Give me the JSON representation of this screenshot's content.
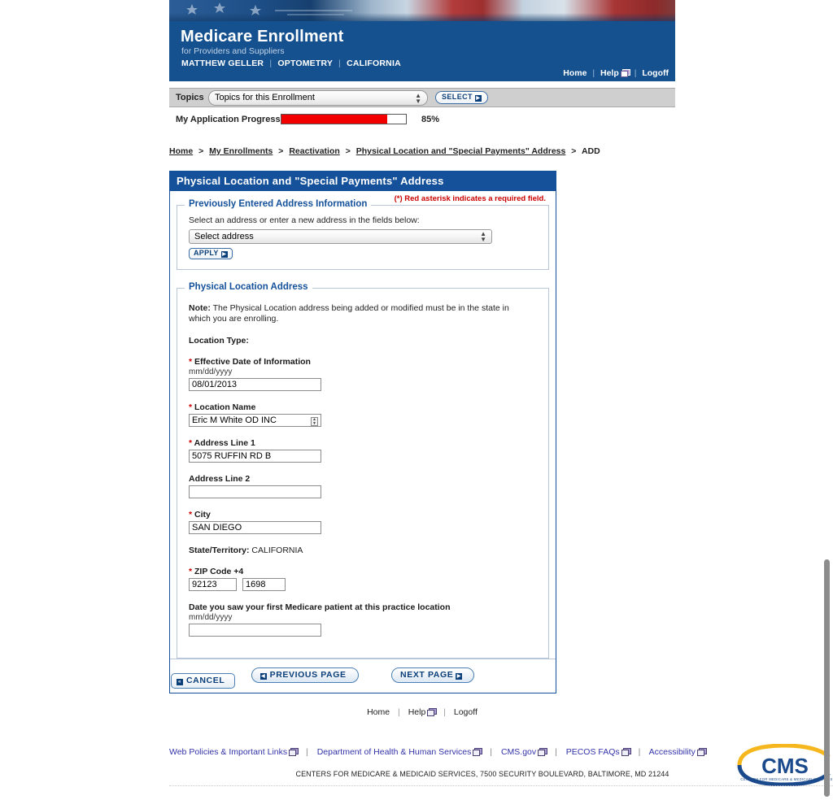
{
  "banner": {
    "title": "Medicare Enrollment",
    "subtitle": "for Providers and Suppliers",
    "user_name": "MATTHEW GELLER",
    "specialty": "OPTOMETRY",
    "state": "CALIFORNIA",
    "links": {
      "home": "Home",
      "help": "Help",
      "logoff": "Logoff"
    },
    "colors": {
      "banner_blue": "#15508f",
      "panel_blue": "#14519a"
    }
  },
  "topics": {
    "label": "Topics",
    "selected": "Topics for this Enrollment",
    "select_button": "SELECT"
  },
  "progress": {
    "label": "My Application Progress",
    "percent_text": "85%",
    "percent_value": 85,
    "fill_color": "#f20000"
  },
  "breadcrumb": {
    "items": [
      {
        "label": "Home",
        "link": true
      },
      {
        "label": "My Enrollments",
        "link": true
      },
      {
        "label": "Reactivation",
        "link": true
      },
      {
        "label": "Physical Location and \"Special Payments\" Address",
        "link": true
      },
      {
        "label": "ADD",
        "link": false
      }
    ],
    "separator": ">"
  },
  "panel": {
    "title": "Physical Location and \"Special Payments\" Address",
    "required_note": "(*) Red asterisk indicates a required field.",
    "required_note_color": "#cc0000"
  },
  "previous_address": {
    "legend": "Previously Entered Address Information",
    "instruction": "Select an address or enter a new address in the fields below:",
    "select_value": "Select address",
    "apply_button": "APPLY"
  },
  "physical_address": {
    "legend": "Physical Location Address",
    "note_label": "Note:",
    "note_text": "The Physical Location address being added or modified must be in the state in which you are enrolling.",
    "location_type_label": "Location Type:",
    "location_type_value": "",
    "fields": {
      "effective_date": {
        "label": "Effective Date of Information",
        "required": true,
        "hint": "mm/dd/yyyy",
        "value": "08/01/2013"
      },
      "location_name": {
        "label": "Location Name",
        "required": true,
        "value": "Eric M White OD INC"
      },
      "address_line_1": {
        "label": "Address Line 1",
        "required": true,
        "value": "5075 RUFFIN RD B"
      },
      "address_line_2": {
        "label": "Address Line 2",
        "required": false,
        "value": ""
      },
      "city": {
        "label": "City",
        "required": true,
        "value": "SAN DIEGO"
      },
      "state_territory": {
        "label": "State/Territory:",
        "value": "CALIFORNIA"
      },
      "zip": {
        "label": "ZIP Code +4",
        "required": true,
        "zip5": "92123",
        "zip4": "1698"
      },
      "first_patient_date": {
        "label": "Date you saw your first Medicare patient at this practice location",
        "required": false,
        "hint": "mm/dd/yyyy",
        "value": ""
      }
    }
  },
  "nav": {
    "previous": "PREVIOUS PAGE",
    "next": "NEXT PAGE",
    "cancel": "CANCEL"
  },
  "footer": {
    "nav_links": [
      "Home",
      "Help",
      "Logoff"
    ],
    "policy_links": [
      "Web Policies & Important Links",
      "Department of Health & Human Services",
      "CMS.gov",
      "PECOS FAQs",
      "Accessibility"
    ],
    "address": "CENTERS FOR MEDICARE & MEDICAID SERVICES, 7500 SECURITY BOULEVARD, BALTIMORE, MD 21244",
    "logo_text": "CMS",
    "logo_tagline": "CENTERS FOR MEDICARE & MEDICAID SERVICES"
  }
}
